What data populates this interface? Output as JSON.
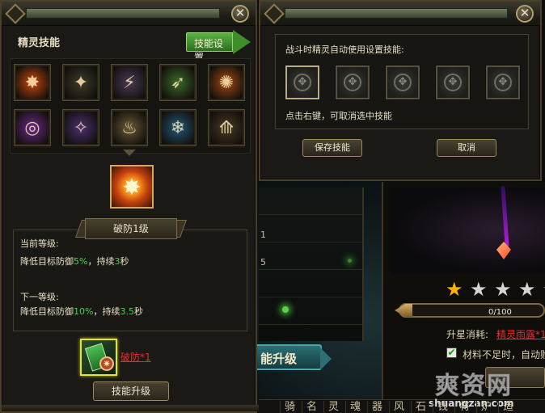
{
  "left_panel": {
    "title": "精灵技能",
    "skill_setting_label": "技能设置",
    "close_glyph": "✕",
    "skills": [
      {
        "icon": "fire-burst-icon",
        "color": "#c4470f",
        "glyph": "✸"
      },
      {
        "icon": "beast-claw-icon",
        "color": "#3d3a2a",
        "glyph": "✦"
      },
      {
        "icon": "lightning-strike-icon",
        "color": "#4a3a55",
        "glyph": "⚡"
      },
      {
        "icon": "green-slash-icon",
        "color": "#3a6a2a",
        "glyph": "➶"
      },
      {
        "icon": "flame-aura-icon",
        "color": "#a04a14",
        "glyph": "✺"
      },
      {
        "icon": "purple-vortex-icon",
        "color": "#6a2a8a",
        "glyph": "◎"
      },
      {
        "icon": "arcane-blast-icon",
        "color": "#4a3070",
        "glyph": "✧"
      },
      {
        "icon": "whirlwind-icon",
        "color": "#6a5a3a",
        "glyph": "♨"
      },
      {
        "icon": "ice-wave-icon",
        "color": "#1f5a7a",
        "glyph": "❄"
      },
      {
        "icon": "earth-spike-icon",
        "color": "#4a3a24",
        "glyph": "⟰"
      }
    ],
    "selected_skill": {
      "icon": "fire-burst-icon",
      "glyph": "✸",
      "name_level": "破防1级"
    },
    "current_level_label": "当前等级:",
    "current_prefix": "降低目标防御",
    "current_value": "5%",
    "current_mid": "，持续",
    "current_duration": "3",
    "current_suffix": "秒",
    "next_level_label": "下一等级:",
    "next_prefix": "降低目标防御",
    "next_value": "10%",
    "next_mid": "，持续",
    "next_duration": "3.5",
    "next_suffix": "秒",
    "item": {
      "icon": "skill-book-icon",
      "label": "破防*1"
    },
    "upgrade_label": "技能升级"
  },
  "right_panel": {
    "close_glyph": "✕",
    "header": "战斗时精灵自动使用设置技能:",
    "slot_count": 5,
    "hint": "点击右键，可取消选中技能",
    "save_label": "保存技能",
    "cancel_label": "取消"
  },
  "background": {
    "list_rows": [
      "",
      "1",
      "5",
      "",
      ""
    ],
    "upgrade_button": "能升级",
    "stars_filled": 1,
    "stars_total": 5,
    "progress_text": "0/100",
    "progress": 0,
    "star_cost_label": "升星消耗:",
    "star_cost_value": "精灵雨露*1",
    "auto_buy_checked": true,
    "auto_buy_label": "材料不足时，自动购",
    "tabs": [
      "骑",
      "名",
      "灵",
      "魂",
      "器",
      "风",
      "石",
      "钱",
      "将",
      "炉",
      "造"
    ],
    "watermark_cn": "爽资网",
    "watermark_en": "shuangzan.com"
  }
}
